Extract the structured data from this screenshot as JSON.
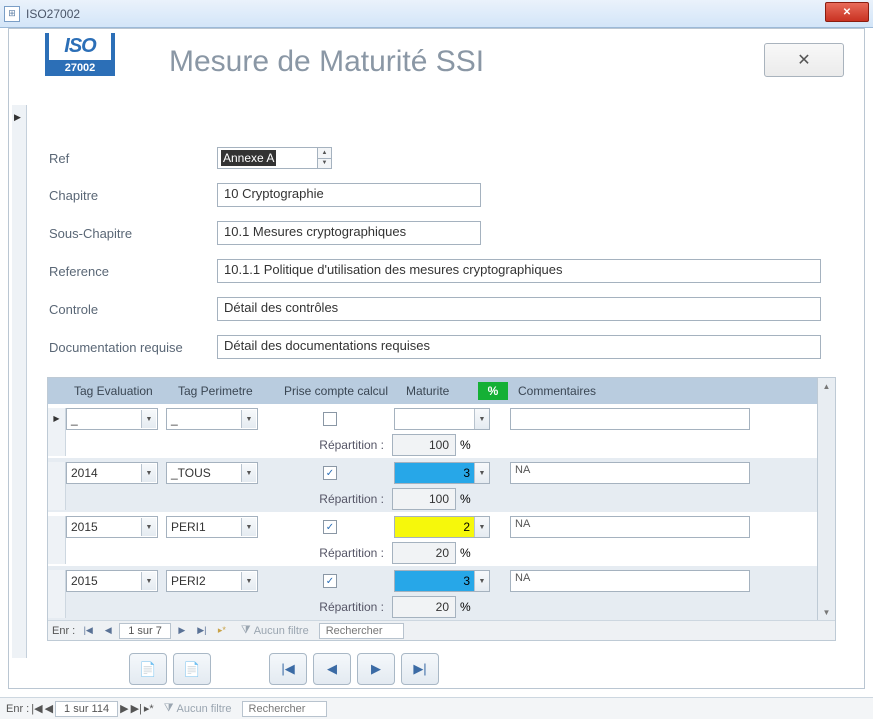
{
  "window": {
    "title": "ISO27002",
    "close": "✕"
  },
  "logo": {
    "iso": "ISO",
    "num": "27002"
  },
  "page_title": "Mesure de Maturité SSI",
  "close_button": "✕",
  "fields": {
    "ref_label": "Ref",
    "ref_value": "Annexe A",
    "chapitre_label": "Chapitre",
    "chapitre_value": "10 Cryptographie",
    "souschap_label": "Sous-Chapitre",
    "souschap_value": "10.1 Mesures cryptographiques",
    "reference_label": "Reference",
    "reference_value": "10.1.1 Politique d'utilisation des mesures cryptographiques",
    "controle_label": "Controle",
    "controle_value": "Détail des contrôles",
    "doc_label": "Documentation requise",
    "doc_value": "Détail des documentations requises"
  },
  "subform": {
    "headers": {
      "tageval": "Tag Evaluation",
      "tagperi": "Tag Perimetre",
      "prise": "Prise compte calcul",
      "mat": "Maturite",
      "pct": "%",
      "comm": "Commentaires"
    },
    "repartition_label": "Répartition :",
    "pct_sign": "%",
    "rows": [
      {
        "tageval": "_",
        "tagperi": "_",
        "checked": false,
        "maturity": "",
        "mat_color": "",
        "repart": "100",
        "comment": ""
      },
      {
        "tageval": "2014",
        "tagperi": "_TOUS",
        "checked": true,
        "maturity": "3",
        "mat_color": "blue",
        "repart": "100",
        "comment": "NA"
      },
      {
        "tageval": "2015",
        "tagperi": "PERI1",
        "checked": true,
        "maturity": "2",
        "mat_color": "yellow",
        "repart": "20",
        "comment": "NA"
      },
      {
        "tageval": "2015",
        "tagperi": "PERI2",
        "checked": true,
        "maturity": "3",
        "mat_color": "blue",
        "repart": "20",
        "comment": "NA"
      }
    ],
    "nav": {
      "label": "Enr :",
      "pos": "1 sur 7",
      "filter": "Aucun filtre",
      "search": "Rechercher"
    }
  },
  "outer_nav": {
    "label": "Enr :",
    "pos": "1 sur 114",
    "filter": "Aucun filtre",
    "search": "Rechercher"
  }
}
